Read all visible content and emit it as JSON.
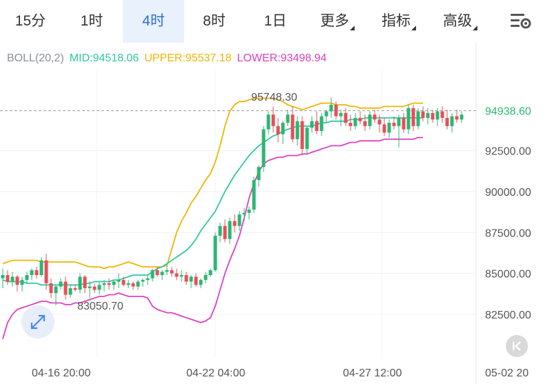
{
  "tabs": [
    {
      "label": "15分",
      "active": false,
      "dropdown": false
    },
    {
      "label": "1时",
      "active": false,
      "dropdown": false
    },
    {
      "label": "4时",
      "active": true,
      "dropdown": false
    },
    {
      "label": "8时",
      "active": false,
      "dropdown": false
    },
    {
      "label": "1日",
      "active": false,
      "dropdown": false
    },
    {
      "label": "更多",
      "active": false,
      "dropdown": true
    },
    {
      "label": "指标",
      "active": false,
      "dropdown": true
    },
    {
      "label": "高级",
      "active": false,
      "dropdown": true
    }
  ],
  "settings_icon": "chart-settings-icon",
  "indicator": {
    "name": "BOLL(20,2)",
    "mid_label": "MID:94518.06",
    "upper_label": "UPPER:95537.18",
    "lower_label": "LOWER:93498.94",
    "colors": {
      "name": "#8a8f99",
      "mid": "#2ec7a0",
      "upper": "#f0b400",
      "lower": "#de3fbf"
    }
  },
  "chart_data": {
    "type": "candlestick",
    "x_ticks": [
      "04-16 20:00",
      "04-22 04:00",
      "04-27 12:00",
      "05-02 20"
    ],
    "y_ticks": [
      82500,
      85000,
      87500,
      90000,
      92500
    ],
    "ylim": [
      81500,
      96800
    ],
    "current_price": 94938.6,
    "current_price_label": "94938.60",
    "annotations": [
      {
        "text": "95748.30",
        "value": 95748.3,
        "kind": "high"
      },
      {
        "text": "83050.70",
        "value": 83050.7,
        "kind": "low"
      }
    ],
    "bands": {
      "upper": [
        85600,
        85700,
        85800,
        85800,
        85800,
        85800,
        85800,
        85800,
        85700,
        85700,
        85700,
        85700,
        85700,
        85700,
        85700,
        85700,
        85600,
        85500,
        85400,
        85400,
        85400,
        85300,
        85400,
        85400,
        85500,
        85600,
        85700,
        85600,
        85500,
        85400,
        85400,
        85400,
        85400,
        85400,
        85500,
        86500,
        87500,
        88200,
        88700,
        89300,
        89700,
        90200,
        90700,
        91100,
        91800,
        92800,
        94000,
        94900,
        95300,
        95500,
        95500,
        95600,
        95700,
        95700,
        95700,
        95700,
        95700,
        95600,
        95500,
        95300,
        95200,
        95100,
        95000,
        95100,
        95200,
        95300,
        95400,
        95400,
        95400,
        95300,
        95300,
        95300,
        95200,
        95200,
        95100,
        95100,
        95100,
        95100,
        95100,
        95200,
        95200,
        95200,
        95200,
        95200,
        95300,
        95400,
        95400,
        95400
      ],
      "mid": [
        84600,
        84500,
        84500,
        84500,
        84500,
        84400,
        84400,
        84400,
        84300,
        84300,
        84300,
        84300,
        84300,
        84300,
        84300,
        84300,
        84300,
        84400,
        84400,
        84500,
        84500,
        84500,
        84500,
        84600,
        84600,
        84700,
        84800,
        84900,
        84900,
        84900,
        84900,
        85100,
        85300,
        85400,
        85600,
        85800,
        86000,
        86200,
        86400,
        86700,
        87100,
        87600,
        88000,
        88400,
        88800,
        89400,
        90000,
        90500,
        91000,
        91400,
        91800,
        92200,
        92500,
        92800,
        93000,
        93200,
        93400,
        93500,
        93700,
        93800,
        93900,
        94000,
        94000,
        94000,
        94000,
        94100,
        94200,
        94200,
        94300,
        94300,
        94300,
        94300,
        94400,
        94400,
        94400,
        94500,
        94500,
        94500,
        94500,
        94500,
        94500,
        94500,
        94500,
        94500,
        94500,
        94500,
        94500,
        94500
      ],
      "lower": [
        81000,
        82000,
        82500,
        82800,
        82900,
        83000,
        83100,
        83200,
        83300,
        83300,
        83200,
        83200,
        83200,
        83100,
        83100,
        83200,
        83200,
        83300,
        83400,
        83500,
        83600,
        83600,
        83700,
        83700,
        83800,
        83700,
        83600,
        83600,
        83600,
        83600,
        83500,
        83000,
        82800,
        82700,
        82600,
        82600,
        82500,
        82400,
        82300,
        82200,
        82100,
        82000,
        82100,
        82300,
        83000,
        84000,
        85000,
        85800,
        86500,
        87300,
        88400,
        89600,
        90500,
        91200,
        91700,
        91900,
        92000,
        92100,
        92100,
        92200,
        92200,
        92200,
        92300,
        92300,
        92400,
        92500,
        92600,
        92700,
        92800,
        92800,
        92800,
        92900,
        93000,
        93000,
        93100,
        93100,
        93100,
        93100,
        93100,
        93200,
        93200,
        93200,
        93200,
        93200,
        93200,
        93200,
        93300,
        93300
      ]
    },
    "candles": [
      [
        84700,
        85300,
        84100,
        84900
      ],
      [
        84900,
        85200,
        84300,
        84500
      ],
      [
        84500,
        85100,
        84200,
        84800
      ],
      [
        84800,
        84900,
        83900,
        84300
      ],
      [
        84300,
        84800,
        83900,
        84600
      ],
      [
        84600,
        85100,
        84400,
        84900
      ],
      [
        84900,
        85300,
        84600,
        85200
      ],
      [
        85200,
        85400,
        84700,
        84900
      ],
      [
        84900,
        86000,
        84800,
        85800
      ],
      [
        85800,
        86200,
        84000,
        84400
      ],
      [
        84400,
        84700,
        83500,
        83800
      ],
      [
        83800,
        84300,
        83050,
        84200
      ],
      [
        84200,
        84700,
        84000,
        84500
      ],
      [
        84500,
        84800,
        83400,
        83700
      ],
      [
        83700,
        84300,
        83500,
        84100
      ],
      [
        84100,
        84300,
        83900,
        84000
      ],
      [
        84000,
        85000,
        83800,
        84800
      ],
      [
        84800,
        84900,
        83800,
        84100
      ],
      [
        84100,
        84500,
        83500,
        84200
      ],
      [
        84200,
        84400,
        83800,
        84000
      ],
      [
        84000,
        84500,
        83700,
        84300
      ],
      [
        84300,
        84600,
        83900,
        84400
      ],
      [
        84400,
        84700,
        84000,
        84300
      ],
      [
        84300,
        84600,
        84000,
        84500
      ],
      [
        84500,
        85000,
        84100,
        84600
      ],
      [
        84600,
        84800,
        84200,
        84300
      ],
      [
        84300,
        84600,
        84100,
        84400
      ],
      [
        84400,
        84500,
        84000,
        84200
      ],
      [
        84200,
        84600,
        84000,
        84500
      ],
      [
        84500,
        84700,
        84200,
        84600
      ],
      [
        84600,
        84900,
        84300,
        84700
      ],
      [
        84700,
        85300,
        84500,
        85200
      ],
      [
        85200,
        85400,
        84800,
        84900
      ],
      [
        84900,
        85200,
        84600,
        85100
      ],
      [
        85100,
        85500,
        84900,
        85200
      ],
      [
        85200,
        85400,
        84800,
        85000
      ],
      [
        85000,
        85300,
        84600,
        84800
      ],
      [
        84800,
        85200,
        84500,
        84900
      ],
      [
        84900,
        85100,
        84300,
        84500
      ],
      [
        84500,
        84900,
        84100,
        84800
      ],
      [
        84800,
        85000,
        84200,
        84300
      ],
      [
        84300,
        84700,
        84100,
        84600
      ],
      [
        84600,
        85100,
        84400,
        84900
      ],
      [
        84900,
        85300,
        84800,
        85200
      ],
      [
        85200,
        87500,
        85100,
        87300
      ],
      [
        87300,
        88100,
        86900,
        87900
      ],
      [
        87900,
        88300,
        86900,
        87100
      ],
      [
        87100,
        88400,
        86800,
        88200
      ],
      [
        88200,
        88600,
        87500,
        87900
      ],
      [
        87900,
        88800,
        87600,
        88600
      ],
      [
        88600,
        89000,
        88200,
        88700
      ],
      [
        88700,
        89100,
        88300,
        88900
      ],
      [
        88900,
        90900,
        88700,
        90700
      ],
      [
        90700,
        91600,
        90300,
        91500
      ],
      [
        91500,
        94000,
        91200,
        93800
      ],
      [
        93800,
        94900,
        93500,
        94700
      ],
      [
        94700,
        95200,
        93600,
        94000
      ],
      [
        94000,
        94500,
        93000,
        93500
      ],
      [
        93500,
        94300,
        92900,
        94200
      ],
      [
        94200,
        95000,
        94000,
        94700
      ],
      [
        94700,
        95200,
        93000,
        93200
      ],
      [
        93200,
        94600,
        92800,
        94300
      ],
      [
        94300,
        94600,
        92200,
        92600
      ],
      [
        92600,
        94000,
        92300,
        93900
      ],
      [
        93900,
        94600,
        93600,
        94300
      ],
      [
        94300,
        94900,
        93500,
        93700
      ],
      [
        93700,
        94800,
        93400,
        94600
      ],
      [
        94600,
        95000,
        94200,
        94900
      ],
      [
        94900,
        95748,
        94500,
        95300
      ],
      [
        95300,
        95500,
        94400,
        94600
      ],
      [
        94600,
        95000,
        94000,
        94800
      ],
      [
        94800,
        95100,
        94000,
        94200
      ],
      [
        94200,
        94700,
        93700,
        94000
      ],
      [
        94000,
        94800,
        93800,
        94500
      ],
      [
        94500,
        94900,
        94100,
        94300
      ],
      [
        94300,
        94700,
        93700,
        94000
      ],
      [
        94000,
        94900,
        93800,
        94700
      ],
      [
        94700,
        95000,
        94200,
        94400
      ],
      [
        94400,
        94700,
        93600,
        94100
      ],
      [
        94100,
        94500,
        93400,
        93600
      ],
      [
        93600,
        94400,
        93300,
        94200
      ],
      [
        94200,
        94600,
        93800,
        94000
      ],
      [
        94000,
        94700,
        92700,
        94500
      ],
      [
        94500,
        94800,
        93600,
        93800
      ],
      [
        93800,
        95300,
        93500,
        95100
      ],
      [
        95100,
        95300,
        93700,
        94000
      ],
      [
        94000,
        95100,
        93800,
        94900
      ],
      [
        94900,
        95200,
        94300,
        94500
      ],
      [
        94500,
        95100,
        94100,
        94800
      ],
      [
        94800,
        95000,
        94200,
        94400
      ],
      [
        94400,
        95100,
        94000,
        94900
      ],
      [
        94900,
        95200,
        94200,
        94500
      ],
      [
        94500,
        95000,
        93800,
        94000
      ],
      [
        94000,
        94800,
        93600,
        94600
      ],
      [
        94600,
        95000,
        94200,
        94400
      ],
      [
        94400,
        94900,
        94200,
        94700
      ]
    ]
  }
}
